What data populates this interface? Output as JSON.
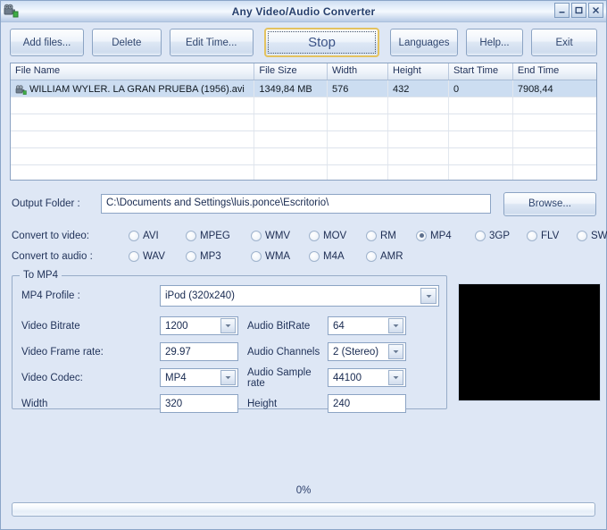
{
  "window": {
    "title": "Any Video/Audio Converter",
    "icon": "film-camera-icon",
    "minimize_label": "–",
    "maximize_label": "□",
    "close_label": "✕"
  },
  "toolbar": {
    "add_files_label": "Add files...",
    "delete_label": "Delete",
    "edit_time_label": "Edit Time...",
    "stop_label": "Stop",
    "languages_label": "Languages",
    "help_label": "Help...",
    "exit_label": "Exit"
  },
  "file_list": {
    "columns": [
      {
        "key": "name",
        "label": "File Name"
      },
      {
        "key": "size",
        "label": "File Size"
      },
      {
        "key": "width",
        "label": "Width"
      },
      {
        "key": "height",
        "label": "Height"
      },
      {
        "key": "start",
        "label": "Start Time"
      },
      {
        "key": "end",
        "label": "End Time"
      }
    ],
    "rows": [
      {
        "name": "WILLIAM WYLER. LA GRAN PRUEBA (1956).avi",
        "size": "1349,84 MB",
        "width": "576",
        "height": "432",
        "start": "0",
        "end": "7908,44",
        "selected": true,
        "icon": "video-file-icon"
      }
    ],
    "empty_row_count": 6
  },
  "output": {
    "label": "Output Folder :",
    "path": "C:\\Documents and Settings\\luis.ponce\\Escritorio\\",
    "placeholder": "C:\\",
    "browse_label": "Browse..."
  },
  "convert_video": {
    "label": "Convert to video:",
    "options": [
      {
        "label": "AVI",
        "checked": false
      },
      {
        "label": "MPEG",
        "checked": false
      },
      {
        "label": "WMV",
        "checked": false
      },
      {
        "label": "MOV",
        "checked": false
      },
      {
        "label": "RM",
        "checked": false
      },
      {
        "label": "MP4",
        "checked": true
      },
      {
        "label": "3GP",
        "checked": false
      },
      {
        "label": "FLV",
        "checked": false
      },
      {
        "label": "SWF",
        "checked": false
      }
    ]
  },
  "convert_audio": {
    "label": "Convert to audio :",
    "options": [
      {
        "label": "WAV",
        "checked": false
      },
      {
        "label": "MP3",
        "checked": false
      },
      {
        "label": "WMA",
        "checked": false
      },
      {
        "label": "M4A",
        "checked": false
      },
      {
        "label": "AMR",
        "checked": false
      }
    ]
  },
  "mp4_settings": {
    "group_title": "To MP4",
    "profile_label": "MP4 Profile :",
    "profile_value": "iPod (320x240)",
    "video_bitrate_label": "Video Bitrate",
    "video_bitrate_value": "1200",
    "audio_bitrate_label": "Audio BitRate",
    "audio_bitrate_value": "64",
    "video_frame_rate_label": "Video Frame rate:",
    "video_frame_rate_value": "29.97",
    "audio_channels_label": "Audio Channels",
    "audio_channels_value": "2 (Stereo)",
    "video_codec_label": "Video Codec:",
    "video_codec_value": "MP4",
    "audio_sample_rate_label": "Audio Sample rate",
    "audio_sample_rate_value": "44100",
    "width_label": "Width",
    "width_value": "320",
    "height_label": "Height",
    "height_value": "240"
  },
  "preview": {
    "name": "video-preview-panel",
    "background_color": "#000000"
  },
  "progress": {
    "percent_label": "0%",
    "percent_value": 0
  },
  "colors": {
    "window_background": "#dee7f5",
    "title_bar": "#cfdef2",
    "accent_focus": "#e3c25f",
    "selection": "#ccddf1",
    "text": "#1f3158"
  }
}
